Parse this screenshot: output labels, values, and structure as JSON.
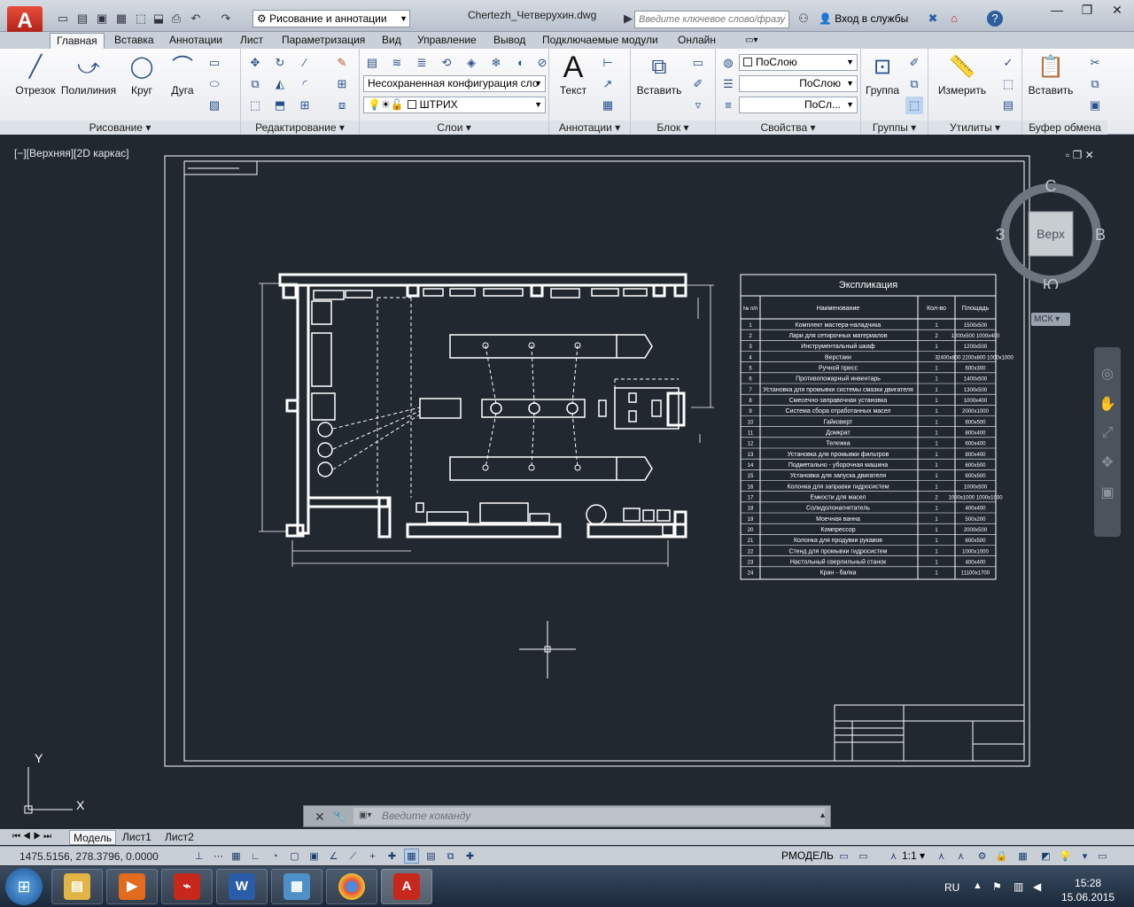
{
  "titlebar": {
    "workspace": "Рисование и аннотации",
    "document": "Chertezh_Четверухин.dwg",
    "search_placeholder": "Введите ключевое слово/фразу",
    "signin": "Вход в службы"
  },
  "tabs": [
    "Главная",
    "Вставка",
    "Аннотации",
    "Лист",
    "Параметризация",
    "Вид",
    "Управление",
    "Вывод",
    "Подключаемые модули",
    "Онлайн"
  ],
  "ribbon": {
    "draw": {
      "title": "Рисование",
      "line": "Отрезок",
      "polyline": "Полилиния",
      "circle": "Круг",
      "arc": "Дуга"
    },
    "modify": {
      "title": "Редактирование"
    },
    "layers": {
      "title": "Слои",
      "layer_state": "Несохраненная конфигурация сло",
      "current_layer": "ШТРИХ"
    },
    "annotation": {
      "title": "Аннотации",
      "text": "Текст"
    },
    "block": {
      "title": "Блок",
      "insert": "Вставить"
    },
    "properties": {
      "title": "Свойства",
      "color": "ПоСлою",
      "linetype": "ПоСлою",
      "lineweight": "ПоСл..."
    },
    "groups": {
      "title": "Группы",
      "group": "Группа"
    },
    "utilities": {
      "title": "Утилиты",
      "measure": "Измерить"
    },
    "clipboard": {
      "title": "Буфер обмена",
      "paste": "Вставить"
    }
  },
  "viewport": {
    "label": "[−][Верхняя][2D каркас]",
    "viewcube": {
      "top": "Верх",
      "north": "С",
      "south": "Ю",
      "west": "З",
      "east": "В"
    },
    "wcs": "МСК",
    "ucs_x": "X",
    "ucs_y": "Y"
  },
  "explication": {
    "title": "Экспликация",
    "headers": [
      "№ п/п",
      "Наименование",
      "Кол-во",
      "Площадь"
    ],
    "rows": [
      [
        "1",
        "Комплект мастера-наладчика",
        "1",
        "1500x500"
      ],
      [
        "2",
        "Лари для сетирочных материалов",
        "2",
        "1000x500 1000x400"
      ],
      [
        "3",
        "Инструментальный шкаф",
        "1",
        "1200x500"
      ],
      [
        "4",
        "Верстаки",
        "3",
        "2400x800 2200x800 1000x1000"
      ],
      [
        "5",
        "Ручной пресс",
        "1",
        "600x300"
      ],
      [
        "6",
        "Противопожарный инвентарь",
        "1",
        "1400x500"
      ],
      [
        "7",
        "Установка для промывки системы смазки двигателя",
        "1",
        "1300x500"
      ],
      [
        "8",
        "Смесечно-заправочная установка",
        "1",
        "1000x400"
      ],
      [
        "9",
        "Система сбора отработанных масел",
        "1",
        "2000x1000"
      ],
      [
        "10",
        "Гайковерт",
        "1",
        "600x500"
      ],
      [
        "11",
        "Домкрат",
        "1",
        "800x400"
      ],
      [
        "12",
        "Тележка",
        "1",
        "600x400"
      ],
      [
        "13",
        "Установка для промывки фильтров",
        "1",
        "800x400"
      ],
      [
        "14",
        "Подметально - уборочная машина",
        "1",
        "600x500"
      ],
      [
        "15",
        "Установка для запуска двигателя",
        "1",
        "600x500"
      ],
      [
        "16",
        "Колонка для заправки гидросистем",
        "1",
        "1000x500"
      ],
      [
        "17",
        "Емкости для масел",
        "2",
        "1000x1000 1000x1000"
      ],
      [
        "18",
        "Солидолонагнетатель",
        "1",
        "400x400"
      ],
      [
        "19",
        "Моечная ванна",
        "1",
        "500x200"
      ],
      [
        "20",
        "Компрессор",
        "1",
        "2000x500"
      ],
      [
        "21",
        "Колонка для продувки рукавов",
        "1",
        "600x500"
      ],
      [
        "22",
        "Стенд для промывки гидросистем",
        "1",
        "1000x1000"
      ],
      [
        "23",
        "Настольный сверлильный станок",
        "1",
        "400x400"
      ],
      [
        "24",
        "Кран - балка",
        "1",
        "11100x1700"
      ]
    ]
  },
  "command": {
    "placeholder": "Введите команду"
  },
  "layout_tabs": [
    "Модель",
    "Лист1",
    "Лист2"
  ],
  "status": {
    "coords": "1475.5156, 278.3796, 0.0000",
    "space": "РМОДЕЛЬ",
    "scale": "1:1"
  },
  "taskbar": {
    "lang": "RU",
    "time": "15:28",
    "date": "15.06.2015"
  },
  "colors": {
    "canvas": "#212830",
    "ribbon": "#eef0f3",
    "accent_red": "#c8281c"
  }
}
